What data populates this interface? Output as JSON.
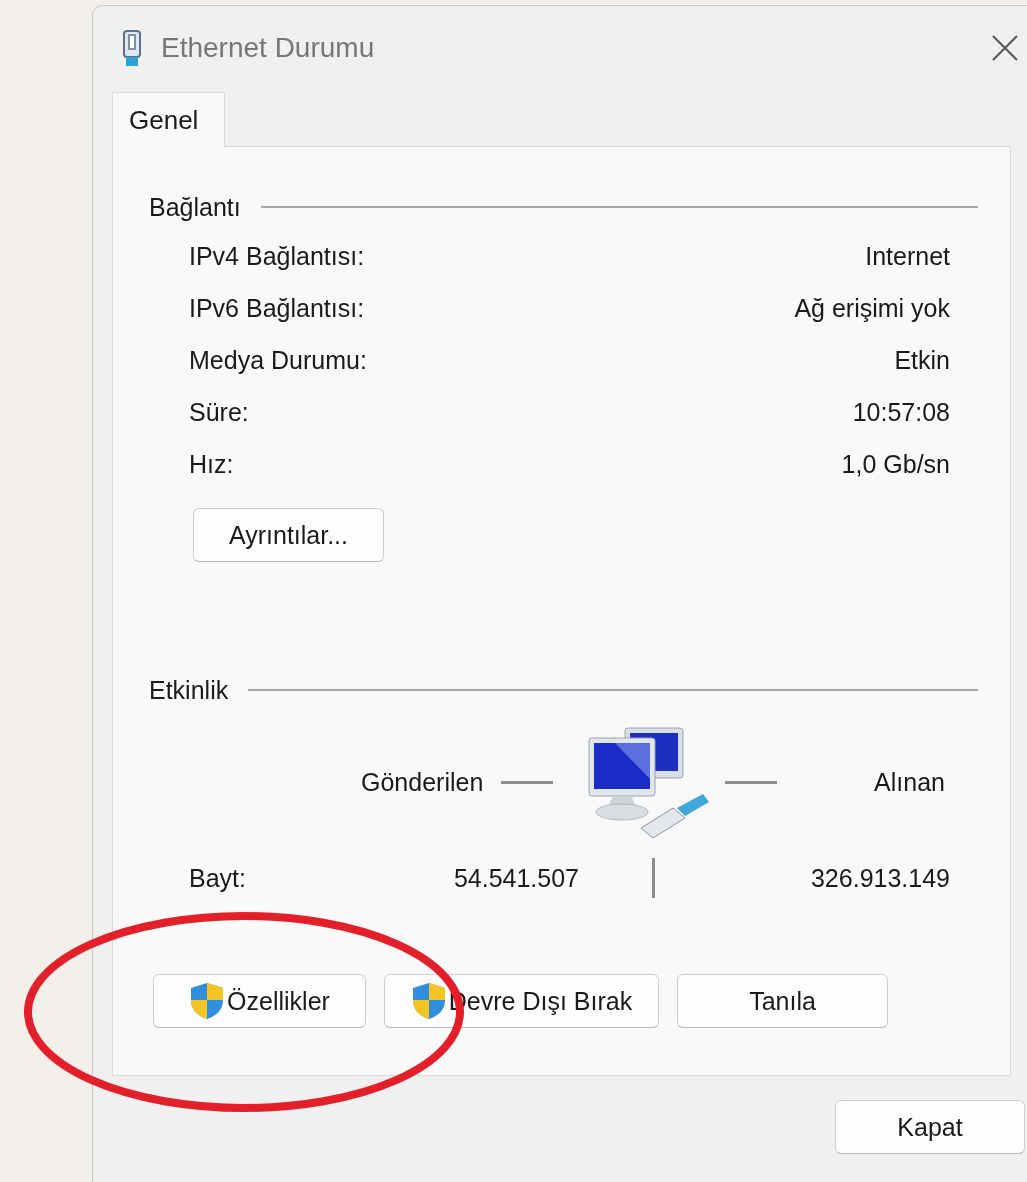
{
  "window": {
    "title": "Ethernet Durumu"
  },
  "tabs": [
    {
      "label": "Genel",
      "selected": true
    }
  ],
  "connection": {
    "heading": "Bağlantı",
    "rows": [
      {
        "label": "IPv4 Bağlantısı:",
        "value": "Internet"
      },
      {
        "label": "IPv6 Bağlantısı:",
        "value": "Ağ erişimi yok"
      },
      {
        "label": "Medya Durumu:",
        "value": "Etkin"
      },
      {
        "label": "Süre:",
        "value": "10:57:08"
      },
      {
        "label": "Hız:",
        "value": "1,0 Gb/sn"
      }
    ],
    "details_button": "Ayrıntılar..."
  },
  "activity": {
    "heading": "Etkinlik",
    "sent_label": "Gönderilen",
    "received_label": "Alınan",
    "bytes_label": "Bayt:",
    "bytes_sent": "54.541.507",
    "bytes_received": "326.913.149"
  },
  "buttons": [
    {
      "label": "Özellikler",
      "shield": true
    },
    {
      "label": "Devre Dışı Bırak",
      "shield": true
    },
    {
      "label": "Tanıla",
      "shield": false
    }
  ],
  "close_button": "Kapat"
}
